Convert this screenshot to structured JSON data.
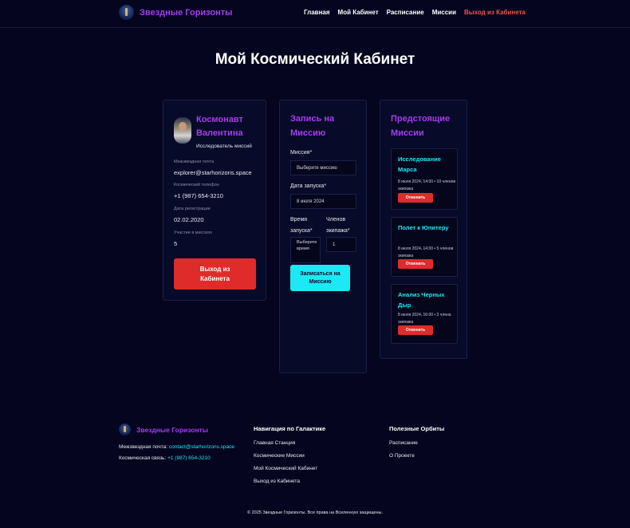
{
  "header": {
    "brand": "Звездные Горизонты",
    "nav": [
      "Главная",
      "Мой Кабинет",
      "Расписание",
      "Миссии"
    ],
    "exit": "Выход из Кабинета"
  },
  "page_title": "Мой Космический Кабинет",
  "profile": {
    "name": "Космонавт Валентина",
    "role": "Исследователь миссий",
    "email_label": "Межзвездная почта",
    "email": "explorer@starhorizons.space",
    "phone_label": "Космический телефон",
    "phone": "+1 (987) 654-3210",
    "reg_label": "Дата регистрации",
    "reg_date": "02.02.2020",
    "missions_label": "Участие в миссиях",
    "missions_count": "5",
    "logout": "Выход из Кабинета"
  },
  "booking": {
    "title": "Запись на Миссию",
    "mission_label": "Миссия*",
    "mission_value": "Выберите миссию",
    "date_label": "Дата запуска*",
    "date_value": "8 июля 2024",
    "time_label": "Время запуска*",
    "time_value": "Выберите время",
    "crew_label": "Членов экипажа*",
    "crew_value": "1",
    "submit": "Записаться на Миссию"
  },
  "upcoming": {
    "title": "Предстоящие Миссии",
    "cancel_label": "Отменить",
    "items": [
      {
        "title": "Исследование Марса",
        "meta": "8 июля 2024, 14:00 • 10 членов экипажа"
      },
      {
        "title": "Полет к Юпитеру",
        "meta": "8 июля 2024, 14:00 • 5 членов экипажа"
      },
      {
        "title": "Анализ Черных Дыр",
        "meta": "8 июля 2024, 16:00 • 3 члена экипажа"
      }
    ]
  },
  "footer": {
    "brand": "Звездные Горизонты",
    "email_prefix": "Межзвездная почта:",
    "email": "contact@starhorizons.space",
    "phone_prefix": "Космическая связь:",
    "phone": "+1 (987) 654-3210",
    "nav_title": "Навигация по Галактике",
    "nav_links": [
      "Главная Станция",
      "Космические Миссии",
      "Мой Космический Кабинет",
      "Выход из Кабинета"
    ],
    "useful_title": "Полезные Орбиты",
    "useful_links": [
      "Расписание",
      "О Проекте"
    ],
    "copyright": "© 2025 Звездные Горизонты. Все права на Вселенную защищены."
  }
}
